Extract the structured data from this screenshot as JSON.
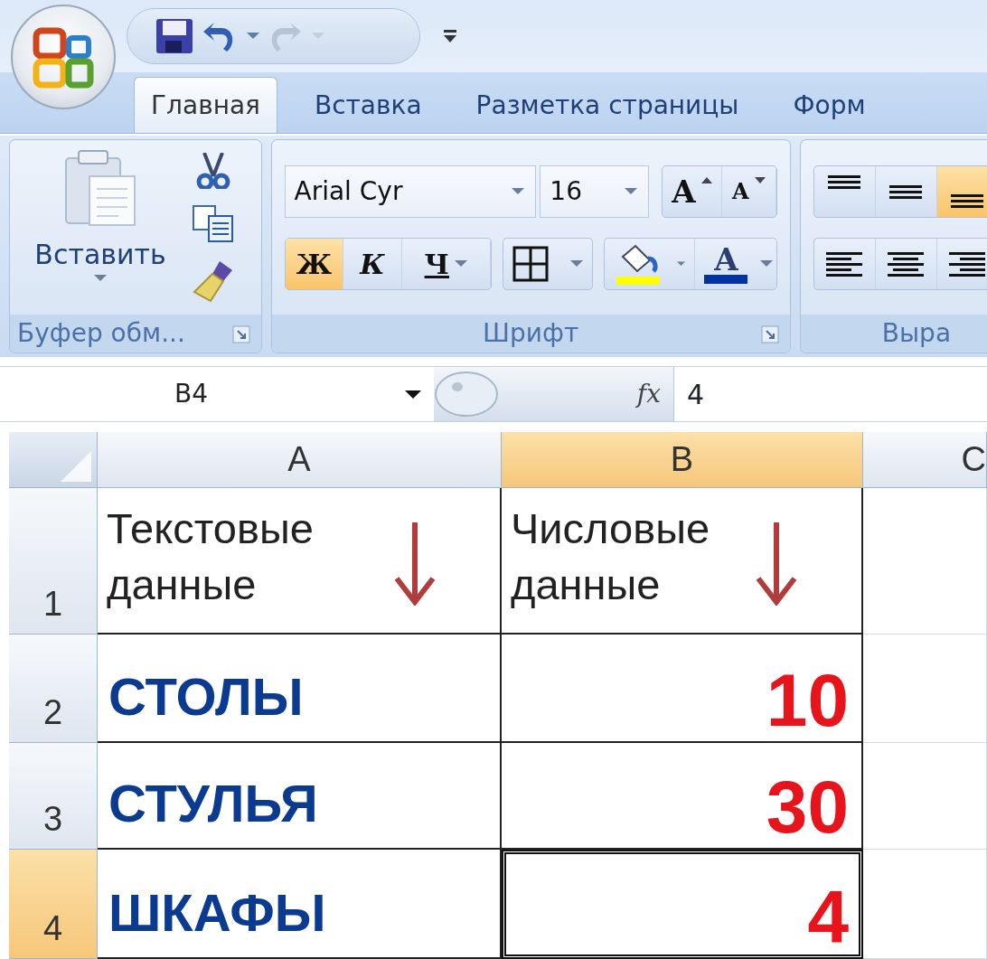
{
  "quick_access": [
    {
      "kind": "save",
      "disabled": false
    },
    {
      "kind": "undo",
      "disabled": false
    },
    {
      "kind": "redo",
      "disabled": true
    }
  ],
  "tabs": [
    {
      "label": "Главная",
      "selected": true
    },
    {
      "label": "Вставка",
      "selected": false
    },
    {
      "label": "Разметка страницы",
      "selected": false
    },
    {
      "label": "Форм",
      "selected": false
    }
  ],
  "ribbon": {
    "clipboard": {
      "paste_label": "Вставить",
      "label": "Буфер обм..."
    },
    "font": {
      "font_name": "Arial Cyr",
      "font_size": "16",
      "size_buttons": [
        {
          "kind": "grow",
          "label": "A"
        },
        {
          "kind": "shrink",
          "label": "A"
        }
      ],
      "style_buttons": [
        {
          "kind": "bold",
          "label": "Ж",
          "selected": true
        },
        {
          "kind": "italic",
          "label": "К",
          "selected": false
        },
        {
          "kind": "underline",
          "label": "Ч",
          "selected": false
        }
      ],
      "fill_color": {
        "color": "#ffff00"
      },
      "font_color": {
        "label": "A",
        "color": "#0033a0"
      },
      "label": "Шрифт"
    },
    "alignment": {
      "label": "Выра",
      "rows": [
        [
          {
            "kind": "top",
            "selected": false
          },
          {
            "kind": "middle",
            "selected": false
          },
          {
            "kind": "bottom",
            "selected": true
          }
        ],
        [
          {
            "kind": "left",
            "selected": false
          },
          {
            "kind": "center",
            "selected": false
          },
          {
            "kind": "right",
            "selected": false
          }
        ]
      ]
    }
  },
  "formula_bar": {
    "name_box": "B4",
    "fx": "fx",
    "value": "4"
  },
  "sheet": {
    "columns": [
      {
        "label": "A",
        "selected": false
      },
      {
        "label": "B",
        "selected": true
      },
      {
        "label": "C",
        "selected": false
      }
    ],
    "rows": [
      {
        "label": "1",
        "selected": false,
        "cells": [
          {
            "kind": "heading",
            "text": "Текстовые данные",
            "arrow": true,
            "selected": false
          },
          {
            "kind": "heading",
            "text": "Числовые данные",
            "arrow": true,
            "selected": false
          }
        ]
      },
      {
        "label": "2",
        "selected": false,
        "cells": [
          {
            "kind": "text",
            "text": "СТОЛЫ",
            "selected": false
          },
          {
            "kind": "number",
            "text": "10",
            "selected": false
          }
        ]
      },
      {
        "label": "3",
        "selected": false,
        "cells": [
          {
            "kind": "text",
            "text": "СТУЛЬЯ",
            "selected": false
          },
          {
            "kind": "number",
            "text": "30",
            "selected": false
          }
        ]
      },
      {
        "label": "4",
        "selected": true,
        "cells": [
          {
            "kind": "text",
            "text": "ШКАФЫ",
            "selected": false
          },
          {
            "kind": "number",
            "text": "4",
            "selected": true
          }
        ]
      }
    ]
  }
}
